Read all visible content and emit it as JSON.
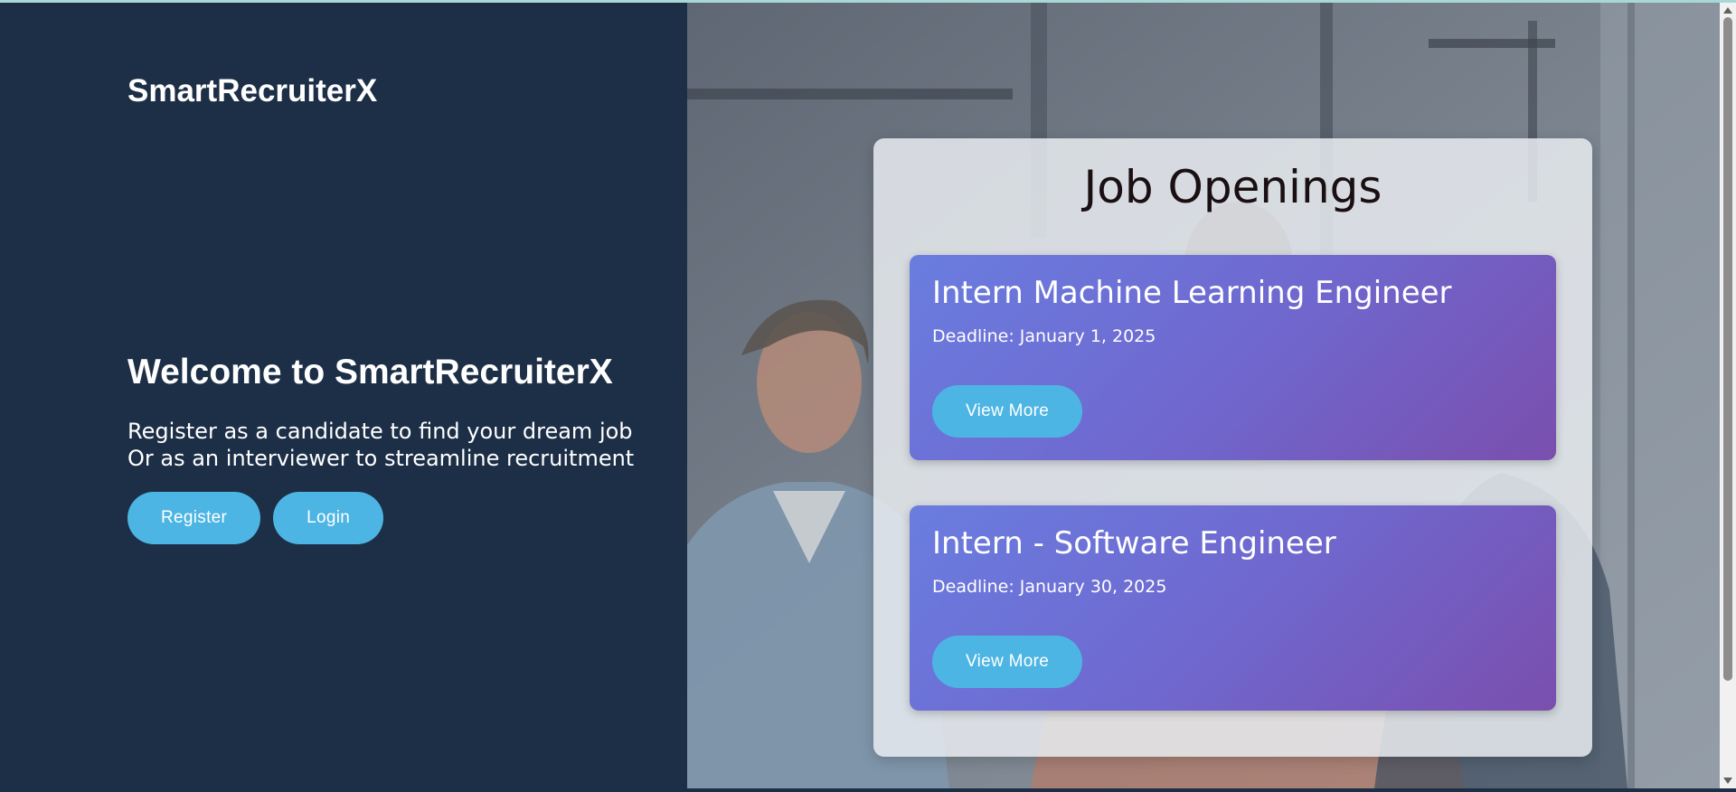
{
  "brand": {
    "name": "SmartRecruiterX"
  },
  "hero": {
    "title": "Welcome to SmartRecruiterX",
    "subtitle_line1": "Register as a candidate to find your dream job",
    "subtitle_line2": "Or as an interviewer to streamline recruitment",
    "register_label": "Register",
    "login_label": "Login"
  },
  "openings": {
    "title": "Job Openings",
    "jobs": [
      {
        "title": "Intern Machine Learning Engineer",
        "deadline": "Deadline: January 1, 2025",
        "button_label": "View More"
      },
      {
        "title": "Intern - Software Engineer",
        "deadline": "Deadline: January 30, 2025",
        "button_label": "View More"
      }
    ]
  },
  "colors": {
    "left_panel_bg": "#1c2f47",
    "accent_button": "#4db5e3",
    "job_card_gradient_start": "#6a7ddf",
    "job_card_gradient_end": "#7a4fae",
    "openings_title_text": "#1a0f12"
  },
  "icons": {
    "scroll_up": "triangle-up-icon",
    "scroll_down": "triangle-down-icon"
  }
}
